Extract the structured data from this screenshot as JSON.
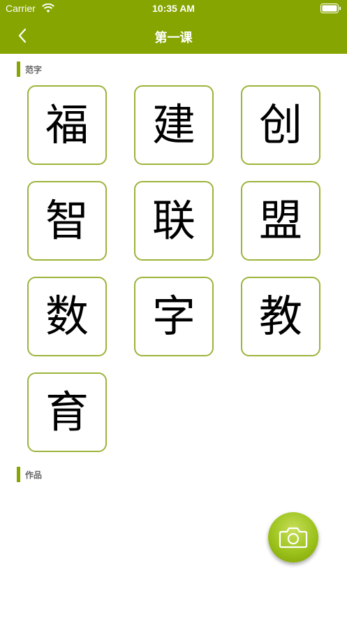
{
  "status_bar": {
    "carrier": "Carrier",
    "time": "10:35 AM"
  },
  "nav": {
    "title": "第一课",
    "back_icon": "chevron-left-icon"
  },
  "sections": {
    "examples_label": "范字",
    "works_label": "作品"
  },
  "characters": [
    "福",
    "建",
    "创",
    "智",
    "联",
    "盟",
    "数",
    "字",
    "教",
    "育"
  ],
  "camera_icon": "camera-icon",
  "colors": {
    "accent": "#86a500",
    "tile_border": "#9ab43a"
  }
}
